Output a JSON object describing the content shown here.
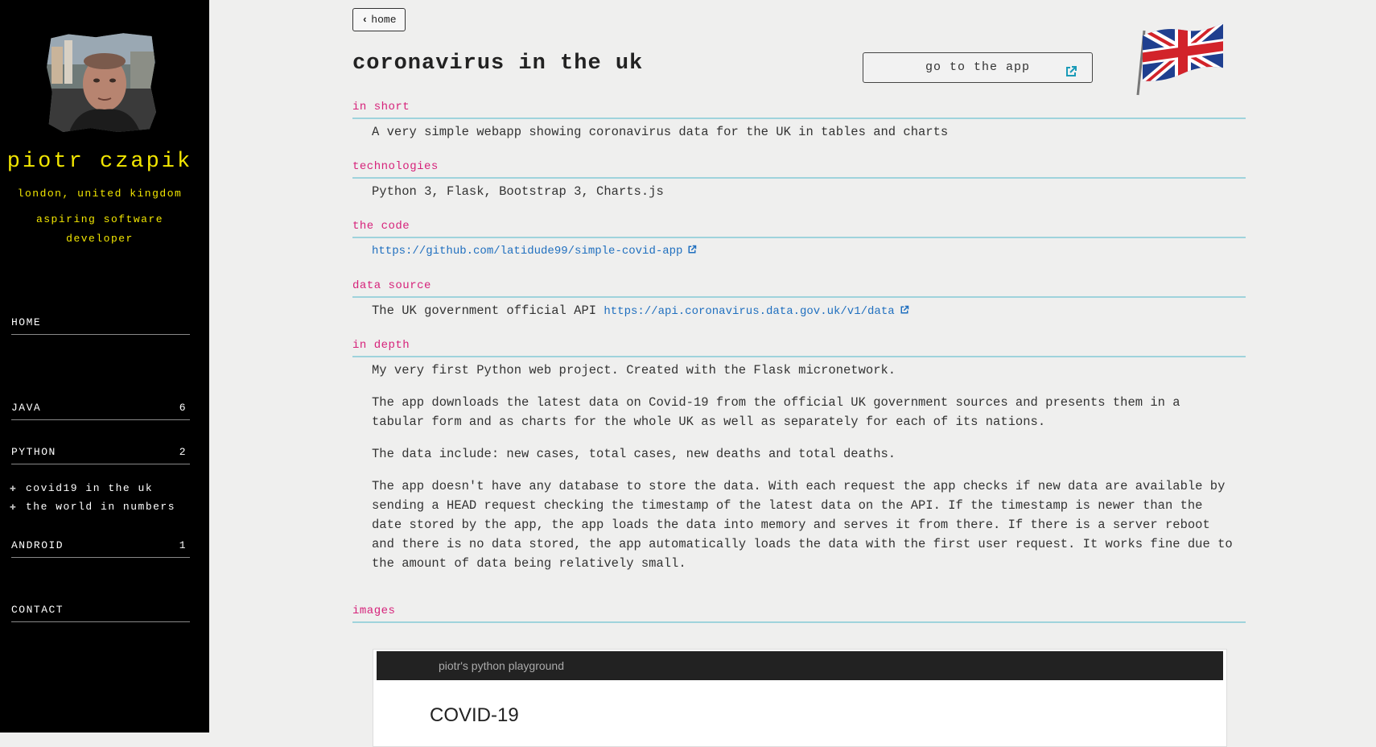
{
  "sidebar": {
    "name": "piotr czapik",
    "location": "london, united kingdom",
    "role": "aspiring software developer",
    "nav": {
      "home": "HOME",
      "java": {
        "label": "JAVA",
        "count": "6"
      },
      "python": {
        "label": "PYTHON",
        "count": "2"
      },
      "python_items": [
        "covid19 in the uk",
        "the world in numbers"
      ],
      "android": {
        "label": "ANDROID",
        "count": "1"
      },
      "contact": "CONTACT"
    }
  },
  "main": {
    "home_button": "home",
    "title": "coronavirus in the uk",
    "app_button": "go to the app",
    "sections": {
      "in_short": {
        "heading": "in short",
        "text": "A very simple webapp showing coronavirus data for the UK in tables and charts"
      },
      "technologies": {
        "heading": "technologies",
        "text": "Python 3, Flask, Bootstrap 3, Charts.js"
      },
      "the_code": {
        "heading": "the code",
        "link": "https://github.com/latidude99/simple-covid-app"
      },
      "data_source": {
        "heading": "data source",
        "text": "The UK government official API",
        "link": "https://api.coronavirus.data.gov.uk/v1/data"
      },
      "in_depth": {
        "heading": "in depth",
        "paragraphs": [
          "My very first Python web project. Created with the Flask micronetwork.",
          "The app downloads the latest data on Covid-19 from the official UK government sources and presents them in a tabular form and as charts for the whole UK as well as separately for each of its nations.",
          "The data include: new cases, total cases, new deaths and total deaths.",
          "The app doesn't have any database to store the data. With each request the app checks if new data are available by sending a HEAD request checking the timestamp of the latest data on the API. If the timestamp is newer than the date stored by the app, the app loads the data into memory and serves it from there. If there is a server reboot and there is no data stored, the app automatically loads the data with the first user request. It works fine due to the amount of data being relatively small."
        ]
      },
      "images": {
        "heading": "images"
      }
    },
    "preview": {
      "navbar_text": "piotr's python playground",
      "heading": "COVID-19"
    }
  },
  "colors": {
    "sidebar_bg": "#000000",
    "sidebar_accent": "#f2e600",
    "section_heading": "#d6227a",
    "section_rule": "#9fd3dc",
    "link": "#1f6fbf"
  }
}
